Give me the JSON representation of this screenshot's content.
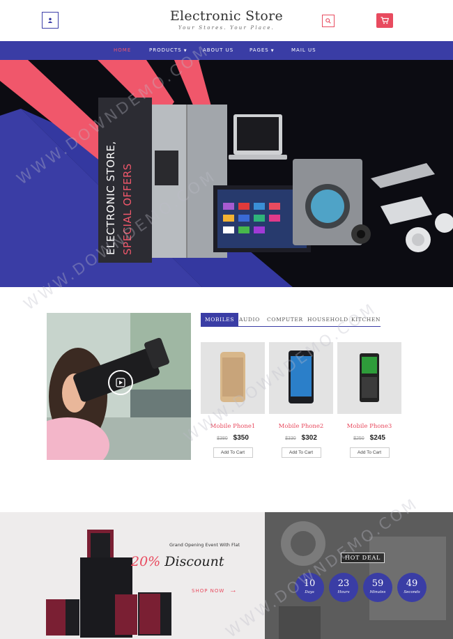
{
  "header": {
    "brand_title": "Electronic Store",
    "brand_tagline": "Your Stores. Your Place.",
    "accent_color": "#e84b5f",
    "primary_color": "#3a3da5",
    "icons": {
      "user": "user-icon",
      "search": "search-icon",
      "cart": "cart-icon"
    }
  },
  "nav": {
    "items": [
      {
        "label": "HOME",
        "active": true
      },
      {
        "label": "PRODUCTS",
        "dropdown": true
      },
      {
        "label": "ABOUT US"
      },
      {
        "label": "PAGES",
        "dropdown": true
      },
      {
        "label": "MAIL US"
      }
    ]
  },
  "hero": {
    "line1": "ELECTRONIC STORE,",
    "line2": "SPECIAL OFFERS"
  },
  "products": {
    "tabs": [
      "MOBILES",
      "AUDIO",
      "COMPUTER",
      "HOUSEHOLD",
      "KITCHEN"
    ],
    "active_tab": "MOBILES",
    "items": [
      {
        "name": "Mobile Phone1",
        "old_price": "$380",
        "price": "$350",
        "button": "Add To Cart"
      },
      {
        "name": "Mobile Phone2",
        "old_price": "$330",
        "price": "$302",
        "button": "Add To Cart"
      },
      {
        "name": "Mobile Phone3",
        "old_price": "$250",
        "price": "$245",
        "button": "Add To Cart"
      }
    ]
  },
  "promo": {
    "subtitle": "Grand Opening Event With Flat",
    "percent": "20%",
    "headline": "Discount",
    "cta": "SHOP NOW",
    "arrow": "→"
  },
  "deal": {
    "title": "HOT DEAL",
    "countdown": [
      {
        "value": "10",
        "label": "Days"
      },
      {
        "value": "23",
        "label": "Hours"
      },
      {
        "value": "59",
        "label": "Minutes"
      },
      {
        "value": "49",
        "label": "Seconds"
      }
    ]
  },
  "watermark": "WWW.DOWNDEMO.COM"
}
